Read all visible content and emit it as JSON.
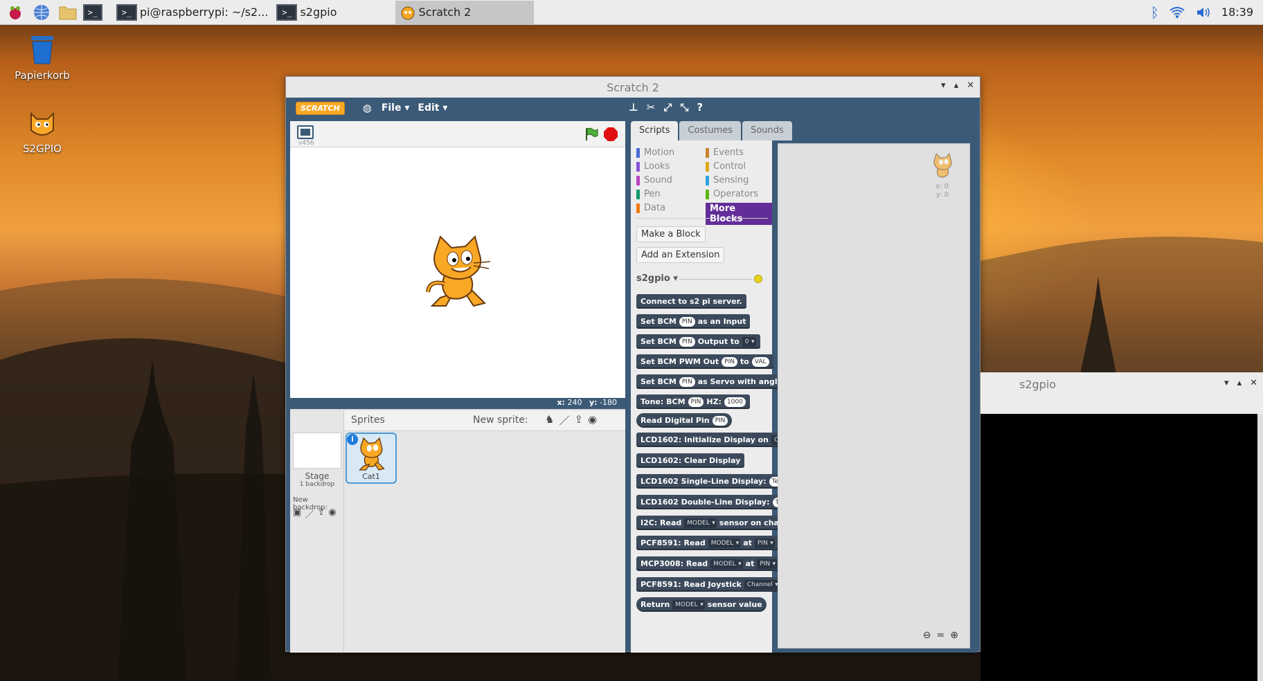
{
  "taskbar": {
    "tasks": [
      {
        "label": "pi@raspberrypi: ~/s2..."
      },
      {
        "label": "s2gpio"
      },
      {
        "label": "Scratch 2"
      }
    ],
    "clock": "18:39"
  },
  "desktop": {
    "icons": [
      {
        "label": "Papierkorb",
        "icon": "trash-icon"
      },
      {
        "label": "S2GPIO",
        "icon": "scratch-cat-icon"
      }
    ]
  },
  "scratch_window": {
    "title": "Scratch 2",
    "menu": {
      "logo": "SCRATCH",
      "file": "File",
      "edit": "Edit"
    },
    "stage": {
      "version": "v456",
      "x_label": "x:",
      "x_value": "240",
      "y_label": "y:",
      "y_value": "-180"
    },
    "sprites": {
      "header": "Sprites",
      "new_sprite": "New sprite:",
      "stage_label": "Stage",
      "backdrop_count": "1 backdrop",
      "new_backdrop": "New backdrop:",
      "items": [
        {
          "name": "Cat1"
        }
      ]
    },
    "tabs": [
      "Scripts",
      "Costumes",
      "Sounds"
    ],
    "categories": {
      "left": [
        {
          "label": "Motion",
          "color": "#4a6cd4"
        },
        {
          "label": "Looks",
          "color": "#8a55d7"
        },
        {
          "label": "Sound",
          "color": "#bb42c3"
        },
        {
          "label": "Pen",
          "color": "#0e9a6c"
        },
        {
          "label": "Data",
          "color": "#ee7d16"
        }
      ],
      "right": [
        {
          "label": "Events",
          "color": "#c88330"
        },
        {
          "label": "Control",
          "color": "#e1a91a"
        },
        {
          "label": "Sensing",
          "color": "#2ca5e2"
        },
        {
          "label": "Operators",
          "color": "#5cb712"
        },
        {
          "label": "More Blocks",
          "color": "#632d99"
        }
      ]
    },
    "buttons": {
      "make_block": "Make a Block",
      "add_extension": "Add an Extension"
    },
    "extension": {
      "name": "s2gpio",
      "status_color": "#e8d51a"
    },
    "blocks": [
      {
        "parts": [
          {
            "t": "Connect to s2 pi server."
          }
        ]
      },
      {
        "parts": [
          {
            "t": "Set BCM"
          },
          {
            "s": "PIN"
          },
          {
            "t": "as an Input"
          }
        ]
      },
      {
        "parts": [
          {
            "t": "Set BCM"
          },
          {
            "s": "PIN"
          },
          {
            "t": "Output to"
          },
          {
            "d": "0"
          }
        ]
      },
      {
        "parts": [
          {
            "t": "Set BCM PWM Out"
          },
          {
            "s": "PIN"
          },
          {
            "t": "to"
          },
          {
            "s": "VAL"
          }
        ]
      },
      {
        "parts": [
          {
            "t": "Set BCM"
          },
          {
            "s": "PIN"
          },
          {
            "t": "as Servo with angle"
          }
        ]
      },
      {
        "parts": [
          {
            "t": "Tone: BCM"
          },
          {
            "s": "PIN"
          },
          {
            "t": "HZ:"
          },
          {
            "s": "1000"
          }
        ]
      },
      {
        "parts": [
          {
            "t": "Read Digital Pin"
          },
          {
            "s": "PIN"
          }
        ],
        "reporter": true
      },
      {
        "parts": [
          {
            "t": "LCD1602: Initialize Display on"
          },
          {
            "d": "Cha"
          }
        ]
      },
      {
        "parts": [
          {
            "t": "LCD1602: Clear Display"
          }
        ]
      },
      {
        "parts": [
          {
            "t": "LCD1602 Single-Line Display:"
          },
          {
            "s": "Text"
          }
        ]
      },
      {
        "parts": [
          {
            "t": "LCD1602 Double-Line Display:"
          },
          {
            "s": "Tex"
          }
        ]
      },
      {
        "parts": [
          {
            "t": "I2C: Read"
          },
          {
            "d": "MODEL"
          },
          {
            "t": "sensor on cha"
          }
        ]
      },
      {
        "parts": [
          {
            "t": "PCF8591: Read"
          },
          {
            "d": "MODEL"
          },
          {
            "t": "at"
          },
          {
            "d": "PIN"
          }
        ]
      },
      {
        "parts": [
          {
            "t": "MCP3008: Read"
          },
          {
            "d": "MODEL"
          },
          {
            "t": "at"
          },
          {
            "d": "PIN"
          }
        ]
      },
      {
        "parts": [
          {
            "t": "PCF8591: Read Joystick"
          },
          {
            "d": "Channel"
          }
        ]
      },
      {
        "parts": [
          {
            "t": "Return"
          },
          {
            "d": "MODEL"
          },
          {
            "t": "sensor value"
          }
        ],
        "reporter": true
      }
    ],
    "script_area": {
      "sprite_x": "x: 0",
      "sprite_y": "y: 0"
    }
  },
  "terminal_window": {
    "title": "s2gpio"
  }
}
